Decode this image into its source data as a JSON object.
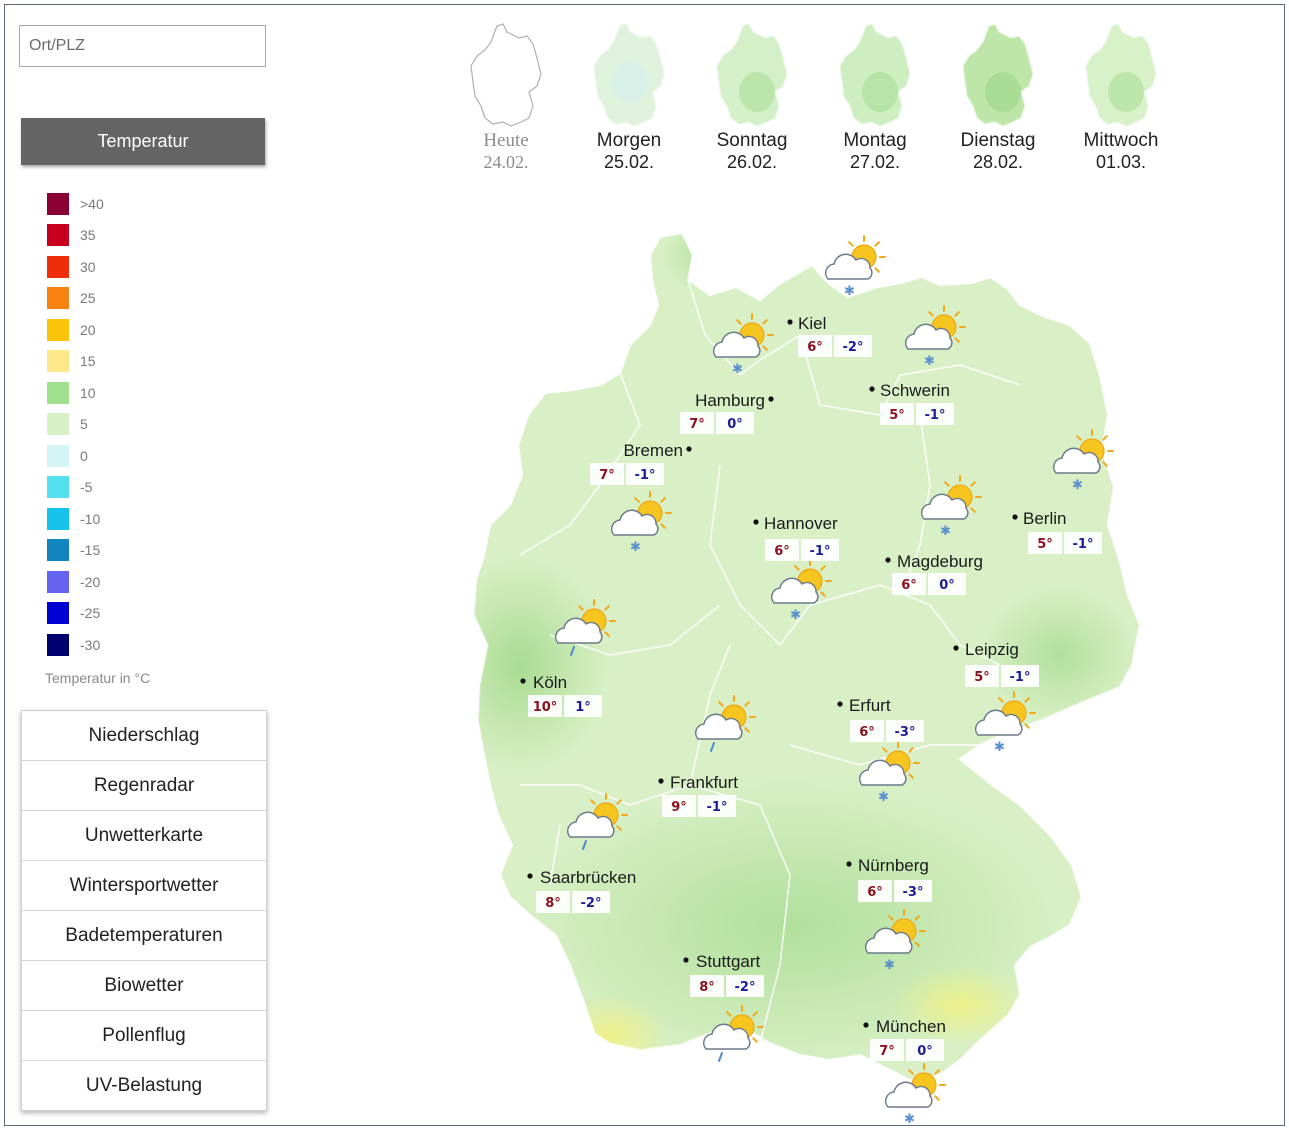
{
  "search": {
    "placeholder": "Ort/PLZ"
  },
  "active_layer": "Temperatur",
  "legend": {
    "items": [
      {
        "label": ">40",
        "color": "#8b0033"
      },
      {
        "label": "35",
        "color": "#c8001e"
      },
      {
        "label": "30",
        "color": "#f02d0a"
      },
      {
        "label": "25",
        "color": "#f58211"
      },
      {
        "label": "20",
        "color": "#fbc30a"
      },
      {
        "label": "15",
        "color": "#fbe88a"
      },
      {
        "label": "10",
        "color": "#9fe08f"
      },
      {
        "label": "5",
        "color": "#d6f2c5"
      },
      {
        "label": "0",
        "color": "#d3f3f5"
      },
      {
        "label": "-5",
        "color": "#54e1ef"
      },
      {
        "label": "-10",
        "color": "#16c3ea"
      },
      {
        "label": "-15",
        "color": "#1185bd"
      },
      {
        "label": "-20",
        "color": "#6464f0"
      },
      {
        "label": "-25",
        "color": "#0000d2"
      },
      {
        "label": "-30",
        "color": "#00006e"
      }
    ],
    "caption": "Temperatur in °C"
  },
  "menu": {
    "items": [
      "Niederschlag",
      "Regenradar",
      "Unwetterkarte",
      "Wintersportwetter",
      "Badetemperaturen",
      "Biowetter",
      "Pollenflug",
      "UV-Belastung"
    ]
  },
  "days": [
    {
      "name": "Heute",
      "date": "24.02."
    },
    {
      "name": "Morgen",
      "date": "25.02."
    },
    {
      "name": "Sonntag",
      "date": "26.02."
    },
    {
      "name": "Montag",
      "date": "27.02."
    },
    {
      "name": "Dienstag",
      "date": "28.02."
    },
    {
      "name": "Mittwoch",
      "date": "01.03."
    }
  ],
  "cities": [
    {
      "name": "Kiel",
      "max": "6°",
      "min": "-2°",
      "icon": "sun-cloud-snow-icon"
    },
    {
      "name": "Hamburg",
      "max": "7°",
      "min": "0°",
      "icon": "sun-cloud-snow-icon"
    },
    {
      "name": "Schwerin",
      "max": "5°",
      "min": "-1°",
      "icon": "sun-cloud-snow-icon"
    },
    {
      "name": "Bremen",
      "max": "7°",
      "min": "-1°",
      "icon": "sun-cloud-snow-icon"
    },
    {
      "name": "Berlin",
      "max": "5°",
      "min": "-1°",
      "icon": "sun-cloud-snow-icon"
    },
    {
      "name": "Hannover",
      "max": "6°",
      "min": "-1°",
      "icon": "sun-cloud-snow-icon"
    },
    {
      "name": "Magdeburg",
      "max": "6°",
      "min": "0°",
      "icon": "sun-cloud-snow-icon"
    },
    {
      "name": "Leipzig",
      "max": "5°",
      "min": "-1°",
      "icon": "sun-cloud-snow-icon"
    },
    {
      "name": "Köln",
      "max": "10°",
      "min": "1°",
      "icon": "sun-cloud-rain-icon"
    },
    {
      "name": "Erfurt",
      "max": "6°",
      "min": "-3°",
      "icon": "sun-cloud-snow-icon"
    },
    {
      "name": "Frankfurt",
      "max": "9°",
      "min": "-1°",
      "icon": "sun-cloud-rain-icon"
    },
    {
      "name": "Saarbrücken",
      "max": "8°",
      "min": "-2°",
      "icon": "sun-cloud-rain-icon"
    },
    {
      "name": "Nürnberg",
      "max": "6°",
      "min": "-3°",
      "icon": "sun-cloud-snow-icon"
    },
    {
      "name": "Stuttgart",
      "max": "8°",
      "min": "-2°",
      "icon": "sun-cloud-rain-icon"
    },
    {
      "name": "München",
      "max": "7°",
      "min": "0°",
      "icon": "sun-cloud-snow-icon"
    }
  ],
  "colors": {
    "max_temp": "#8b1020",
    "min_temp": "#1c1c9a",
    "map_fill": "#d9f0c6",
    "map_warm": "#b8e3a2"
  }
}
